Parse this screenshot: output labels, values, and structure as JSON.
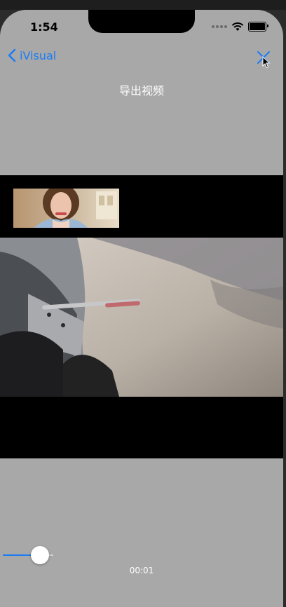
{
  "status_bar": {
    "time": "1:54"
  },
  "nav": {
    "back_label": "iVisual"
  },
  "page": {
    "title": "导出视频"
  },
  "player": {
    "current_time": "00:01",
    "progress": 0.7
  },
  "colors": {
    "accent": "#1a7cf5",
    "background": "#a8a8a8",
    "video_background": "#000000"
  },
  "icons": {
    "back": "chevron-left-icon",
    "close": "close-icon"
  }
}
